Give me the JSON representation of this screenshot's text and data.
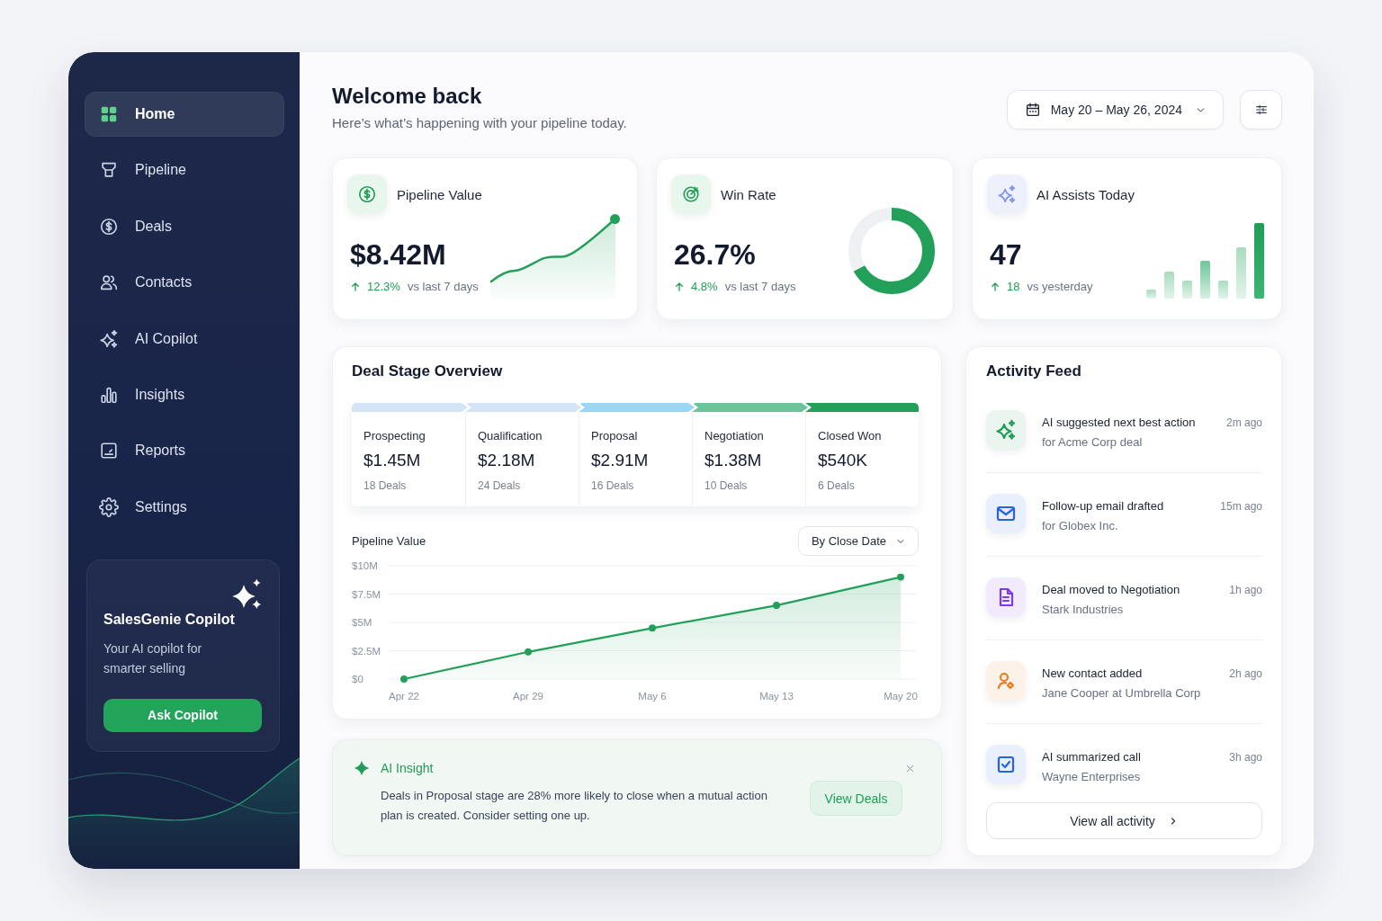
{
  "sidebar": {
    "items": [
      {
        "label": "Home",
        "selected": true
      },
      {
        "label": "Pipeline",
        "selected": false
      },
      {
        "label": "Deals",
        "selected": false
      },
      {
        "label": "Contacts",
        "selected": false
      },
      {
        "label": "AI Copilot",
        "selected": false
      },
      {
        "label": "Insights",
        "selected": false
      },
      {
        "label": "Reports",
        "selected": false
      },
      {
        "label": "Settings",
        "selected": false
      }
    ],
    "promo": {
      "title": "SalesGenie Copilot",
      "text": "Your AI copilot for smarter selling",
      "button": "Ask Copilot"
    }
  },
  "header": {
    "title": "Welcome back",
    "subtitle": "Here’s what’s happening with your pipeline today.",
    "date_range": "May 20 – May 26, 2024"
  },
  "stats": [
    {
      "kind": "sparkline",
      "label": "Pipeline Value",
      "value": "$8.42M",
      "change": "12.3%",
      "comparison": "vs last 7 days"
    },
    {
      "kind": "gauge",
      "label": "Win Rate",
      "value": "26.7%",
      "change": "4.8%",
      "comparison": "vs last 7 days",
      "level": 0.67
    },
    {
      "kind": "bars",
      "label": "AI Assists Today",
      "value": "47",
      "change": "18",
      "comparison": "vs yesterday"
    }
  ],
  "deal_stages": {
    "title": "Deal Stage Overview",
    "stages": [
      {
        "name": "Prospecting",
        "value": "$1.45M",
        "deals": "18 Deals",
        "color": "#d5e3f7"
      },
      {
        "name": "Qualification",
        "value": "$2.18M",
        "deals": "24 Deals",
        "color": "#d5e3f7"
      },
      {
        "name": "Proposal",
        "value": "$2.91M",
        "deals": "16 Deals",
        "color": "#9dd6f2"
      },
      {
        "name": "Negotiation",
        "value": "$1.38M",
        "deals": "10 Deals",
        "color": "#6cc49b"
      },
      {
        "name": "Closed Won",
        "value": "$540K",
        "deals": "6 Deals",
        "color": "#22a05a"
      }
    ]
  },
  "pipeline_chart": {
    "sort": "By Close Date",
    "chart_data": {
      "type": "area",
      "title": "Pipeline Value",
      "categories": [
        "Apr 22",
        "Apr 29",
        "May 6",
        "May 13",
        "May 20"
      ],
      "values": [
        0,
        2.4,
        4.5,
        6.5,
        9.0
      ],
      "ylim": [
        0,
        10
      ],
      "yticks": [
        {
          "value": 0,
          "label": "$0"
        },
        {
          "value": 2.5,
          "label": "$2.5M"
        },
        {
          "value": 5,
          "label": "$5M"
        },
        {
          "value": 7.5,
          "label": "$7.5M"
        },
        {
          "value": 10,
          "label": "$10M"
        }
      ],
      "grid": true
    }
  },
  "ai_insight": {
    "title": "AI Insight",
    "text": "Deals in Proposal stage are 28% more likely to close when a mutual action plan is created. Consider setting one up.",
    "button": "View Deals"
  },
  "activity_feed": {
    "title": "Activity Feed",
    "items": [
      {
        "kind": "ai",
        "title": "AI suggested next best action",
        "detail": "for Acme Corp deal",
        "time": "2m ago",
        "color": "#1f9d55"
      },
      {
        "kind": "email",
        "title": "Follow-up email drafted",
        "detail": "for Globex Inc.",
        "time": "15m ago",
        "color": "#2563eb"
      },
      {
        "kind": "stage",
        "title": "Deal moved to Negotiation",
        "detail": "Stark Industries",
        "time": "1h ago",
        "color": "#7c3aed"
      },
      {
        "kind": "contact",
        "title": "New contact added",
        "detail": "Jane Cooper at Umbrella Corp",
        "time": "2h ago",
        "color": "#ea7c1e"
      },
      {
        "kind": "summary",
        "title": "AI summarized call",
        "detail": "Wayne Enterprises",
        "time": "3h ago",
        "color": "#2563eb"
      }
    ],
    "button": "View all activity"
  }
}
